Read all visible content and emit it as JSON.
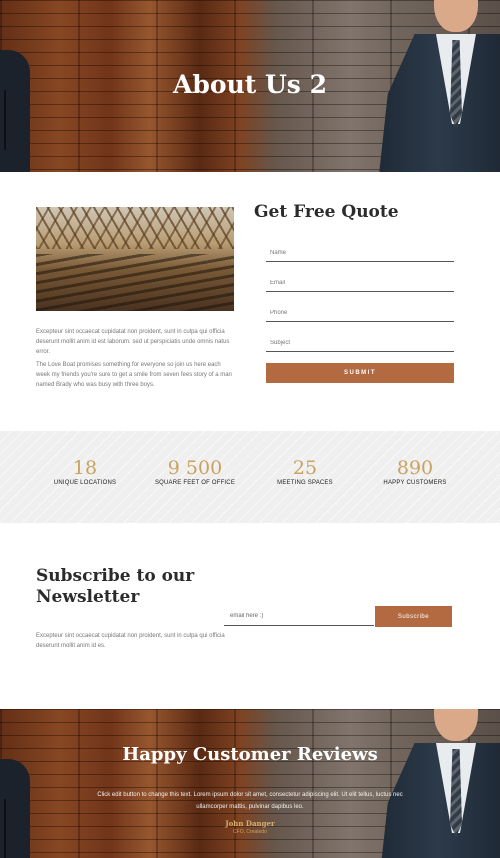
{
  "hero": {
    "title": "About Us 2"
  },
  "about": {
    "paragraph_1": "Excepteur sint occaecat cupidatat non proident, sunt in culpa qui officia deserunt mollit anim id est laborum. sed ut perspiciatis unde omnis natus error.",
    "paragraph_2": "The Love Boat promises something for everyone so join us here each week my friends you're sure to get a smile from seven fees story of a man named Brady who was busy with three boys."
  },
  "quote_form": {
    "title": "Get Free Quote",
    "name_placeholder": "Name",
    "email_placeholder": "Email",
    "phone_placeholder": "Phone",
    "subject_placeholder": "Subject",
    "submit_label": "SUBMIT"
  },
  "stats": [
    {
      "value": "18",
      "label": "UNIQUE LOCATIONS"
    },
    {
      "value": "9 500",
      "label": "SQUARE FEET OF OFFICE"
    },
    {
      "value": "25",
      "label": "MEETING SPACES"
    },
    {
      "value": "890",
      "label": "HAPPY CUSTOMERS"
    }
  ],
  "newsletter": {
    "title": "Subscribe to our Newsletter",
    "text": "Excepteur sint occaecat cupidatat non proident, sunt in culpa qui officia deserunt mollit anim id es.",
    "email_placeholder": "email here :)",
    "button_label": "Subscribe"
  },
  "reviews": {
    "title": "Happy Customer Reviews",
    "text": "Click edit button to change this text. Lorem ipsum dolor sit amet, consectetur adipiscing elit. Ut elit tellus, luctus nec ullamcorper mattis, pulvinar dapibus leo.",
    "author_name": "John Danger",
    "author_role": "CFO, Createdo"
  },
  "colors": {
    "accent": "#b46a41",
    "stat_number": "#c9a25f"
  }
}
